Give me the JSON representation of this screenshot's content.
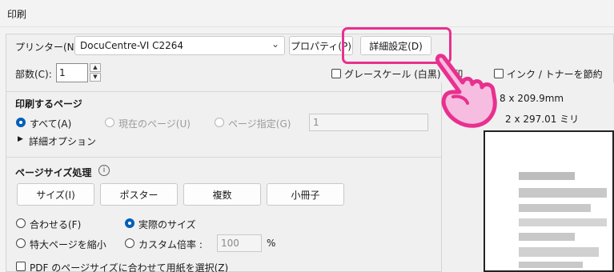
{
  "window": {
    "title": "印刷"
  },
  "printer": {
    "label": "プリンター(N):",
    "selected": "DocuCentre-VI C2264",
    "properties_button": "プロパティ(P)",
    "advanced_button": "詳細設定(D)"
  },
  "copies": {
    "label": "部数(C):",
    "value": "1"
  },
  "options": {
    "grayscale": "グレースケール (白黒) で印",
    "ink_save": "インク / トナーを節約"
  },
  "pages": {
    "heading": "印刷するページ",
    "all": "すべて(A)",
    "current": "現在のページ(U)",
    "specify": "ページ指定(G)",
    "range_value": "1",
    "more_options": "詳細オプション"
  },
  "sizing": {
    "heading": "ページサイズ処理",
    "size_button": "サイズ(I)",
    "poster_button": "ポスター",
    "multiple_button": "複数",
    "booklet_button": "小冊子",
    "fit": "合わせる(F)",
    "actual": "実際のサイズ",
    "shrink": "特大ページを縮小",
    "custom_scale": "カスタム倍率 :",
    "scale_value": "100",
    "percent": "%",
    "pdf_paper": "PDF のページサイズに合わせて用紙を選択(Z)"
  },
  "preview": {
    "size1": "8 x 209.9mm",
    "size2": "2 x 297.01 ミリ"
  },
  "colors": {
    "highlight": "#e8308f",
    "accent": "#005fb8"
  }
}
